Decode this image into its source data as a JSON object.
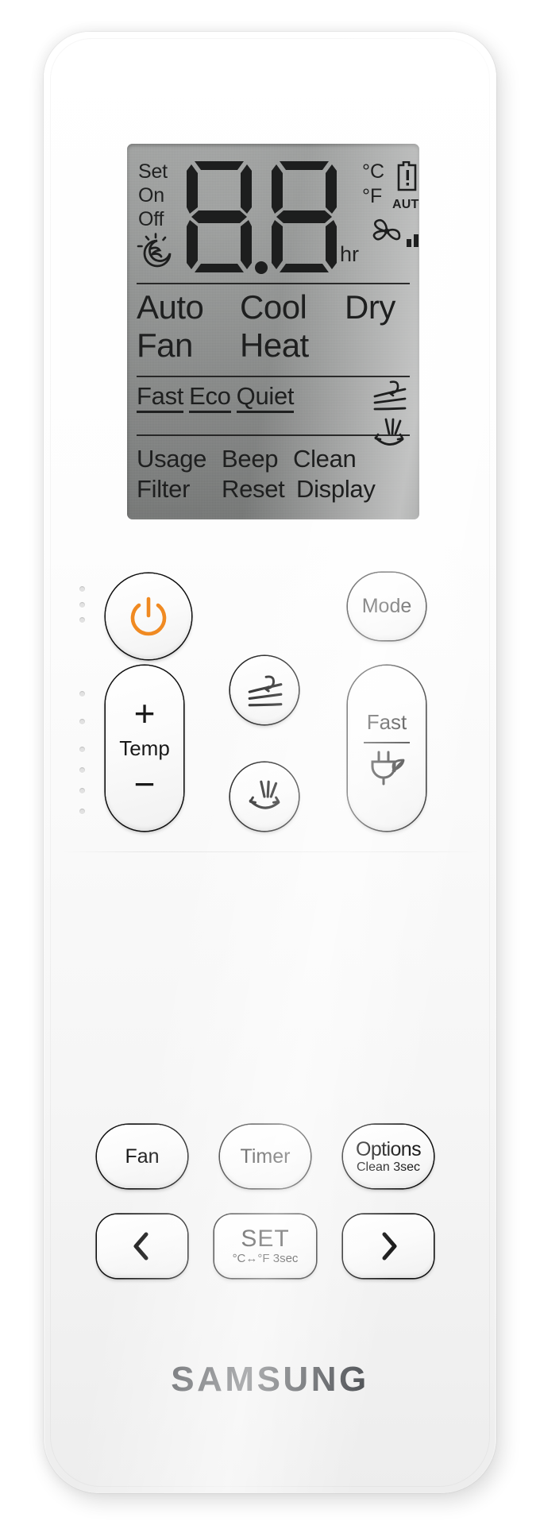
{
  "device": {
    "brand": "SAMSUNG",
    "type": "air-conditioner-remote"
  },
  "display": {
    "timer_labels": [
      "Set",
      "On",
      "Off"
    ],
    "digits": "88",
    "digit_decimal": ".",
    "hour_unit": "hr",
    "unit_celsius": "°C",
    "unit_fahrenheit": "°F",
    "unit_c": "C",
    "unit_f": "F",
    "degree_symbol": "°",
    "auto_label": "AUTO",
    "icons": {
      "sleep": "moon-sleep-icon",
      "battery": "battery-low-icon",
      "transmitter": "remote-transmitter-icon",
      "fan": "fan-icon",
      "signal": "signal-bars-icon",
      "swing_horizontal": "swing-horizontal-icon",
      "swing_vertical": "swing-vertical-icon"
    },
    "modes_row1": [
      "Auto",
      "Cool",
      "Dry"
    ],
    "modes_row2": [
      "Fan",
      "Heat"
    ],
    "options": [
      "Fast",
      "Eco",
      "Quiet"
    ],
    "functions_row1": [
      "Usage",
      "Beep",
      "Clean"
    ],
    "functions_row2": [
      "Filter",
      "Reset",
      "Display"
    ]
  },
  "buttons": {
    "power": {
      "label": "",
      "icon": "power-icon",
      "accent": "#F08A22"
    },
    "mode": {
      "label": "Mode"
    },
    "temp": {
      "plus": "+",
      "minus": "−",
      "label": "Temp"
    },
    "swing_horizontal": {
      "icon": "swing-horizontal-icon"
    },
    "swing_vertical": {
      "icon": "swing-vertical-icon"
    },
    "fast": {
      "label": "Fast",
      "icon": "plug-leaf-icon"
    },
    "fan": {
      "label": "Fan"
    },
    "timer": {
      "label": "Timer"
    },
    "options": {
      "label": "Options",
      "sublabel": "Clean 3sec"
    },
    "prev": {
      "icon": "chevron-left-icon"
    },
    "set": {
      "label": "SET",
      "sublabel": "°C↔°F 3sec"
    },
    "next": {
      "icon": "chevron-right-icon"
    }
  },
  "colors": {
    "body": "#f7f7f7",
    "lcd": "#8e908f",
    "lcd_text": "#1d1e1e",
    "power_accent": "#F08A22",
    "brand_text": "#4c4f53"
  }
}
